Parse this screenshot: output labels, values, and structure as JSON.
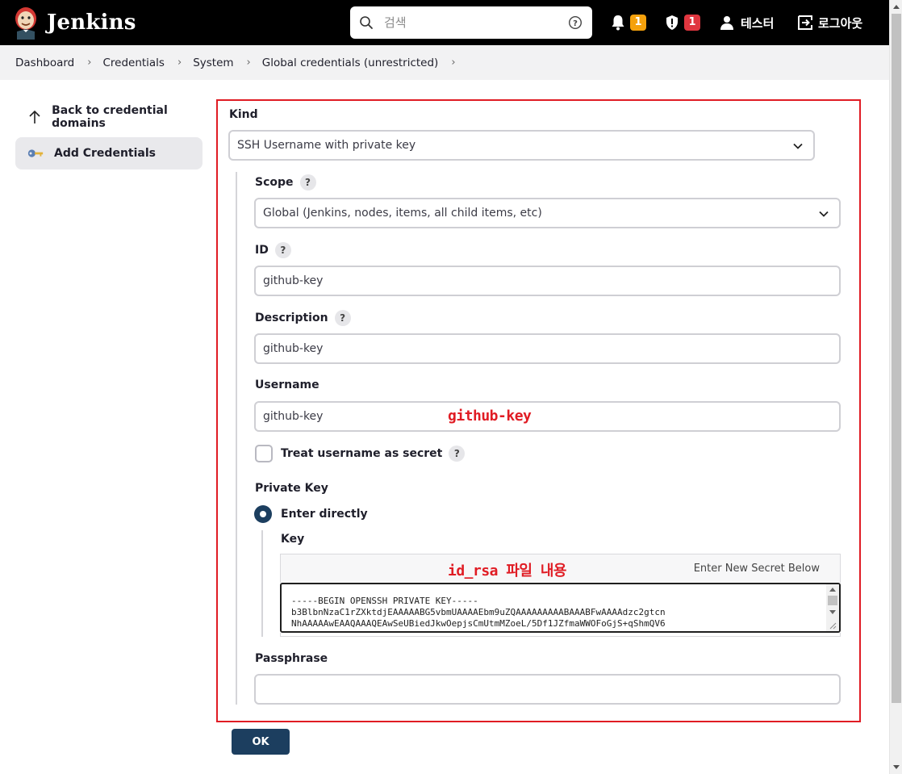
{
  "header": {
    "app_name": "Jenkins",
    "search_placeholder": "검색",
    "notifications_count": "1",
    "security_count": "1",
    "user_name": "테스터",
    "logout_label": "로그아웃",
    "colors": {
      "bg": "#000000",
      "notif_badge": "#f5a10c",
      "security_badge": "#e0363f"
    }
  },
  "breadcrumb": {
    "items": [
      "Dashboard",
      "Credentials",
      "System",
      "Global credentials (unrestricted)"
    ]
  },
  "sidebar": {
    "items": [
      {
        "label": "Back to credential domains",
        "icon": "arrow-up-icon",
        "active": false
      },
      {
        "label": "Add Credentials",
        "icon": "key-icon",
        "active": true
      }
    ]
  },
  "form": {
    "kind_label": "Kind",
    "kind_value": "SSH Username with private key",
    "scope_label": "Scope",
    "scope_value": "Global (Jenkins, nodes, items, all child items, etc)",
    "id_label": "ID",
    "id_value": "github-key",
    "description_label": "Description",
    "description_value": "github-key",
    "username_label": "Username",
    "username_value": "github-key",
    "treat_secret_label": "Treat username as secret",
    "private_key_label": "Private Key",
    "enter_directly_label": "Enter directly",
    "key_label": "Key",
    "secret_hint": "Enter New Secret Below",
    "key_lines": [
      "-----BEGIN OPENSSH PRIVATE KEY-----",
      "b3BlbnNzaC1rZXktdjEAAAAABG5vbmUAAAAEbm9uZQAAAAAAAAABAAABFwAAAAdzc2gtcn",
      "NhAAAAAwEAAQAAAQEAwSeUBiedJkwOepjsCmUtmMZoeL/5Df1JZfmaWWOFoGjS+qShmQV6"
    ],
    "passphrase_label": "Passphrase",
    "passphrase_value": "",
    "ok_label": "OK",
    "help_symbol": "?"
  },
  "annotations": {
    "username_note": "github-key",
    "key_note": "id_rsa 파일 내용",
    "color": "#e01c24"
  }
}
